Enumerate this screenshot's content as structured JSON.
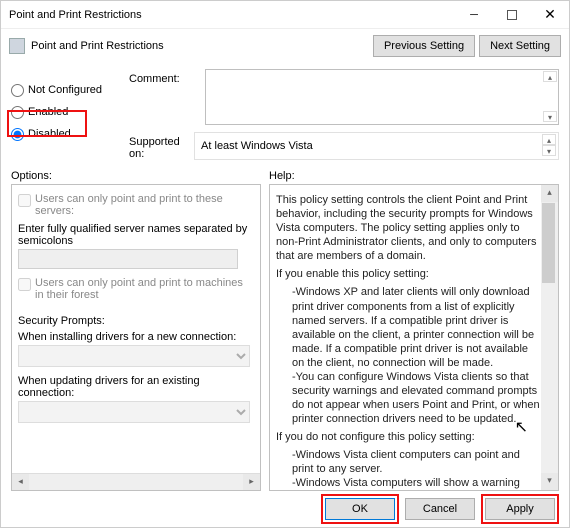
{
  "window": {
    "title": "Point and Print Restrictions"
  },
  "subheader": {
    "title": "Point and Print Restrictions"
  },
  "nav": {
    "prev": "Previous Setting",
    "next": "Next Setting"
  },
  "radios": {
    "not_configured": "Not Configured",
    "enabled": "Enabled",
    "disabled": "Disabled",
    "selected": "disabled"
  },
  "fields": {
    "comment_label": "Comment:",
    "supported_label": "Supported on:",
    "supported_value": "At least Windows Vista"
  },
  "labels": {
    "options": "Options:",
    "help": "Help:"
  },
  "options": {
    "chk1": "Users can only point and print to these servers:",
    "edit_hint": "Enter fully qualified server names separated by semicolons",
    "chk2": "Users can only point and print to machines in their forest",
    "sec_prompts": "Security Prompts:",
    "install_label": "When installing drivers for a new connection:",
    "update_label": "When updating drivers for an existing connection:"
  },
  "help_text": {
    "p1": "This policy setting controls the client Point and Print behavior, including the security prompts for Windows Vista computers. The policy setting applies only to non-Print Administrator clients, and only to computers that are members of a domain.",
    "p2_head": "If you enable this policy setting:",
    "p2_a": "-Windows XP and later clients will only download print driver components from a list of explicitly named servers. If a compatible print driver is available on the client, a printer connection will be made. If a compatible print driver is not available on the client, no connection will be made.",
    "p2_b": "-You can configure Windows Vista clients so that security warnings and elevated command prompts do not appear when users Point and Print, or when printer connection drivers need to be updated.",
    "p3_head": "If you do not configure this policy setting:",
    "p3_a": "-Windows Vista client computers can point and print to any server.",
    "p3_b": "-Windows Vista computers will show a warning and an elevated command prompt when users create a printer"
  },
  "footer": {
    "ok": "OK",
    "cancel": "Cancel",
    "apply": "Apply"
  }
}
